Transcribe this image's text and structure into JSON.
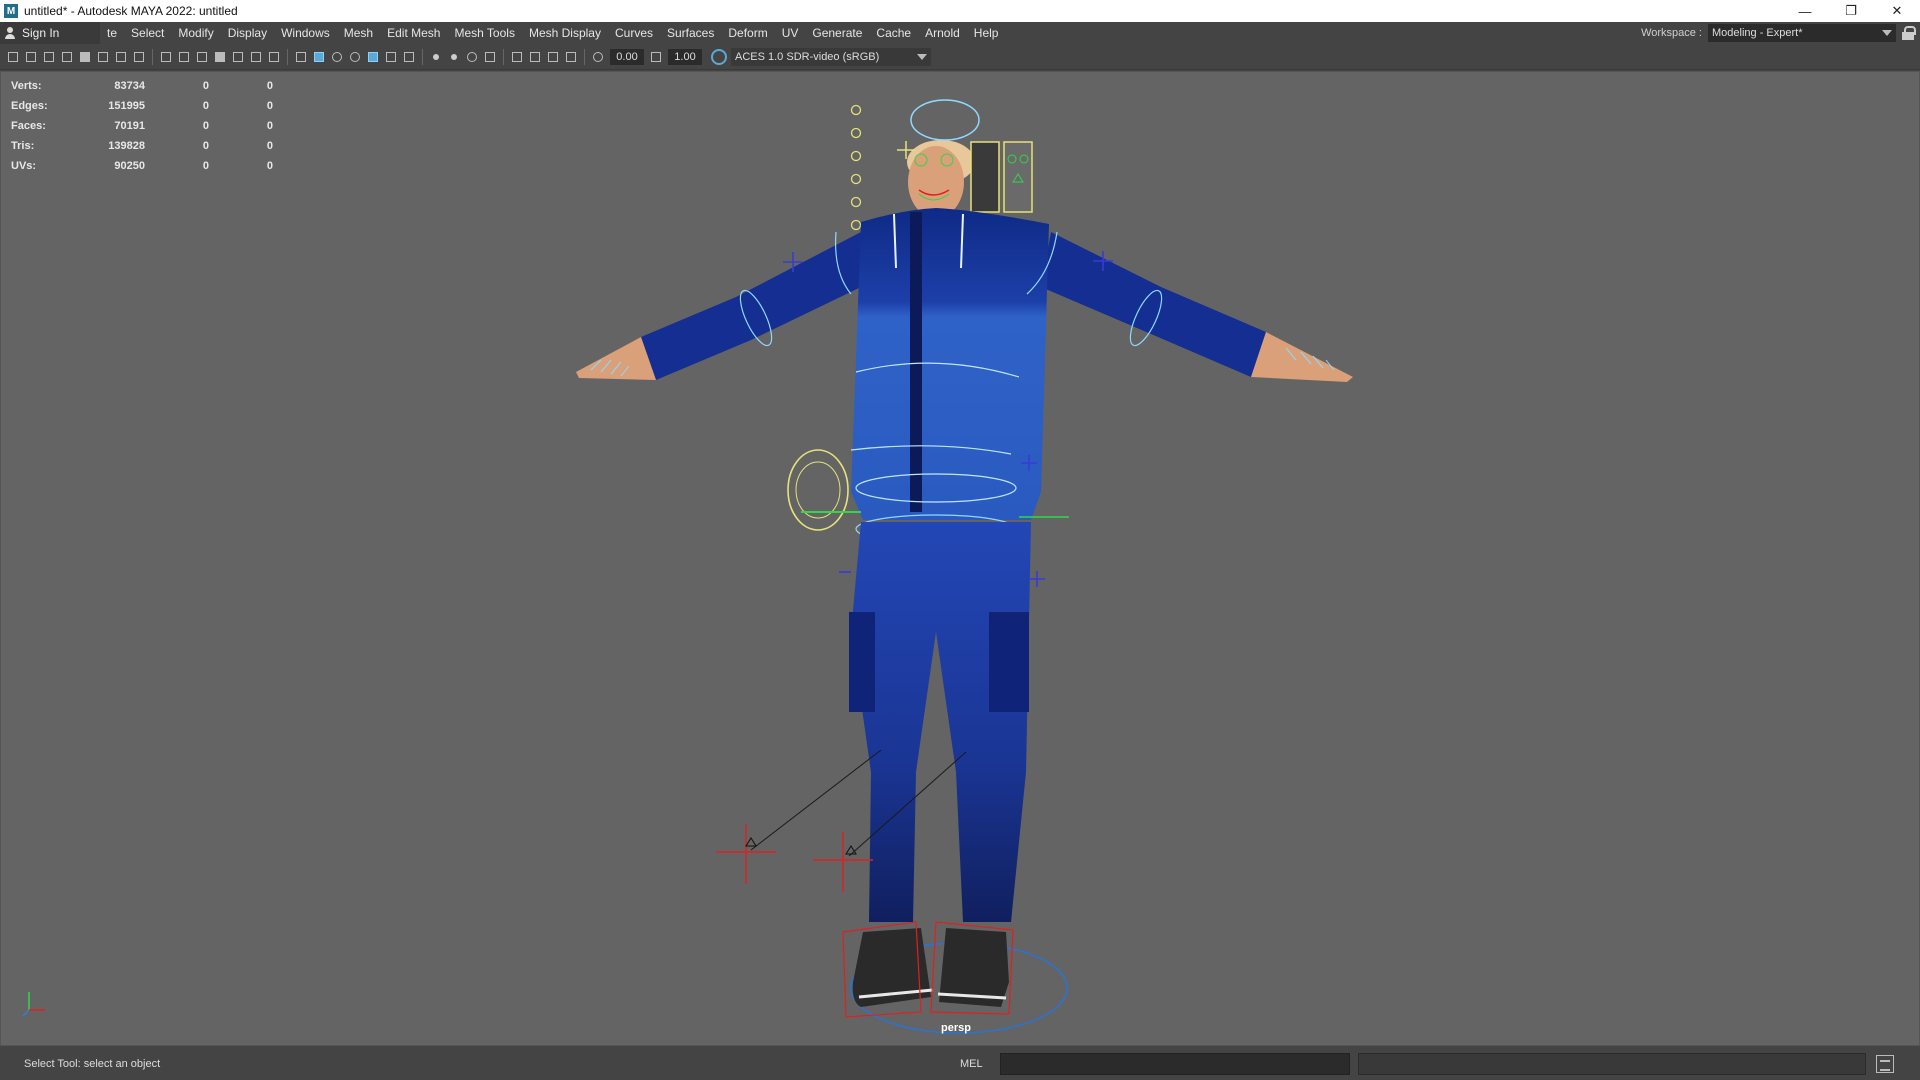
{
  "window": {
    "title": "untitled* - Autodesk MAYA 2022: untitled",
    "icon": "M",
    "controls": [
      "minimize-icon",
      "restore-icon",
      "close-icon"
    ]
  },
  "menubar": {
    "sign_in": "Sign In",
    "items": [
      "te",
      "Select",
      "Modify",
      "Display",
      "Windows",
      "Mesh",
      "Edit Mesh",
      "Mesh Tools",
      "Mesh Display",
      "Curves",
      "Surfaces",
      "Deform",
      "UV",
      "Generate",
      "Cache",
      "Arnold",
      "Help"
    ],
    "workspace_label": "Workspace :",
    "workspace_value": "Modeling - Expert*"
  },
  "toolbar": {
    "field_a": "0.00",
    "field_b": "1.00",
    "color_space": "ACES 1.0 SDR-video (sRGB)"
  },
  "hud": {
    "rows": [
      {
        "label": "Verts:",
        "v1": "83734",
        "v2": "0",
        "v3": "0"
      },
      {
        "label": "Edges:",
        "v1": "151995",
        "v2": "0",
        "v3": "0"
      },
      {
        "label": "Faces:",
        "v1": "70191",
        "v2": "0",
        "v3": "0"
      },
      {
        "label": "Tris:",
        "v1": "139828",
        "v2": "0",
        "v3": "0"
      },
      {
        "label": "UVs:",
        "v1": "90250",
        "v2": "0",
        "v3": "0"
      }
    ]
  },
  "viewport": {
    "camera": "persp",
    "colors": {
      "background": "#646464",
      "jacket_dark": "#1a2f8f",
      "jacket_light": "#2f62c8",
      "pants": "#1f3a9e",
      "skin": "#d9a07a",
      "control_yellow": "#e6e27a",
      "control_cyan": "#8fd9ff",
      "control_green": "#31d64a",
      "control_red": "#e02020",
      "locator_blue": "#3a3ad8"
    }
  },
  "status": {
    "message": "Select Tool: select an object",
    "mel_label": "MEL",
    "command": ""
  }
}
